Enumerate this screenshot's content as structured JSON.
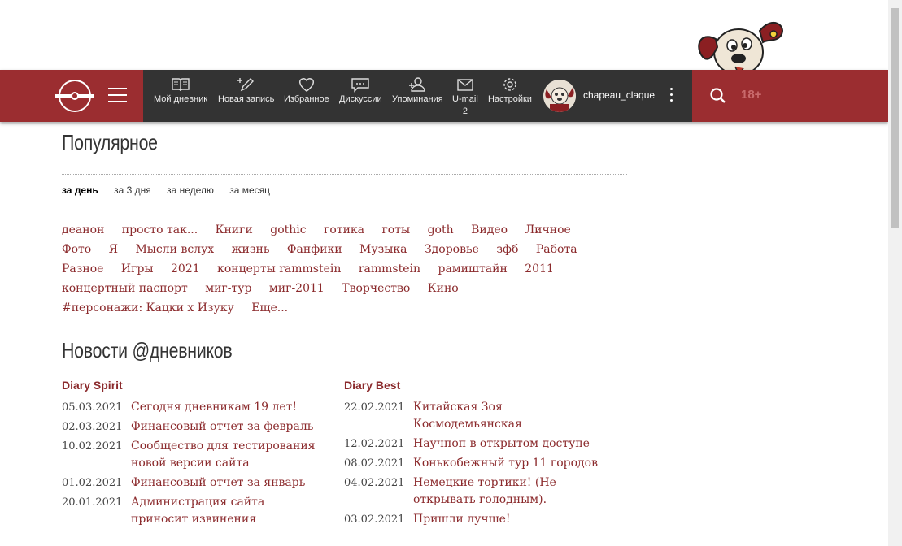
{
  "header": {
    "nav": [
      {
        "label": "Мой дневник",
        "icon": "book-icon"
      },
      {
        "label": "Новая запись",
        "icon": "pen-icon"
      },
      {
        "label": "Избранное",
        "icon": "heart-icon"
      },
      {
        "label": "Дискуссии",
        "icon": "chat-icon"
      },
      {
        "label": "Упоминания",
        "icon": "mention-icon"
      },
      {
        "label": "U-mail",
        "icon": "mail-icon",
        "badge": "2"
      },
      {
        "label": "Настройки",
        "icon": "gear-icon"
      }
    ],
    "username": "chapeau_claque",
    "age_label": "18+",
    "accent": "#9b2d30",
    "dark": "#333333"
  },
  "popular": {
    "title": "Популярное",
    "filters": [
      "за день",
      "за 3 дня",
      "за неделю",
      "за месяц"
    ],
    "active_filter": "за день",
    "tags": [
      "деанон",
      "просто так...",
      "Книги",
      "gothic",
      "готика",
      "готы",
      "goth",
      "Видео",
      "Личное",
      "Фото",
      "Я",
      "Мысли вслух",
      "жизнь",
      "Фанфики",
      "Музыка",
      "Здоровье",
      "зфб",
      "Работа",
      "Разное",
      "Игры",
      "2021",
      "концерты rammstein",
      "rammstein",
      "рамиштайн",
      "2011",
      "концертный паспорт",
      "миг-тур",
      "миг-2011",
      "Творчество",
      "Кино",
      "#персонажи: Кацки х Изуку",
      "Еще..."
    ]
  },
  "news": {
    "title": "Новости @дневников",
    "left": {
      "heading": "Diary Spirit",
      "items": [
        {
          "date": "05.03.2021",
          "text": "Сегодня дневникам 19 лет!"
        },
        {
          "date": "02.03.2021",
          "text": "Финансовый отчет за февраль"
        },
        {
          "date": "10.02.2021",
          "text": "Сообщество для тестирования новой версии сайта"
        },
        {
          "date": "01.02.2021",
          "text": "Финансовый отчет за январь"
        },
        {
          "date": "20.01.2021",
          "text": "Администрация сайта приносит извинения"
        }
      ]
    },
    "right": {
      "heading": "Diary Best",
      "items": [
        {
          "date": "22.02.2021",
          "text": "Китайская Зоя Космодемьянская"
        },
        {
          "date": "12.02.2021",
          "text": "Научпоп в открытом доступе"
        },
        {
          "date": "08.02.2021",
          "text": "Конькобежный тур 11 городов"
        },
        {
          "date": "04.02.2021",
          "text": "Немецкие тортики! (Не открывать голодным)."
        },
        {
          "date": "03.02.2021",
          "text": "Пришли лучше!"
        }
      ]
    }
  }
}
